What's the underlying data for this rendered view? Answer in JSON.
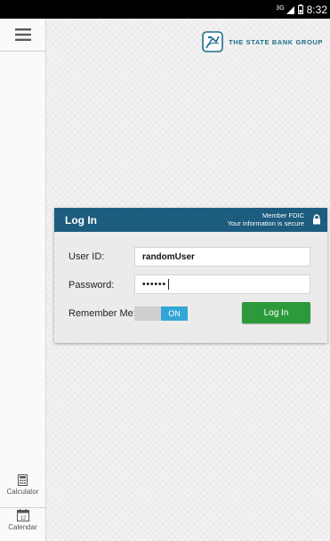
{
  "status_bar": {
    "network": "3G",
    "time": "8:32"
  },
  "sidebar": {
    "menu_icon": "hamburger-menu-icon",
    "tools": [
      {
        "label": "Calculator",
        "icon": "calculator-icon"
      },
      {
        "label": "Calendar",
        "icon": "calendar-icon",
        "icon_text": "12"
      }
    ]
  },
  "brand": {
    "name": "THE STATE BANK GROUP",
    "color": "#1d6c8a"
  },
  "login_card": {
    "title": "Log In",
    "secure_line1": "Member FDIC",
    "secure_line2": "Your information is secure",
    "header_color": "#1c5c7e",
    "user_id_label": "User ID:",
    "user_id_value": "randomUser",
    "password_label": "Password:",
    "password_value": "••••••",
    "remember_label": "Remember Me:",
    "remember_state": "ON",
    "login_button": "Log In",
    "login_button_color": "#2c9a3a",
    "toggle_color": "#33a6d6"
  }
}
